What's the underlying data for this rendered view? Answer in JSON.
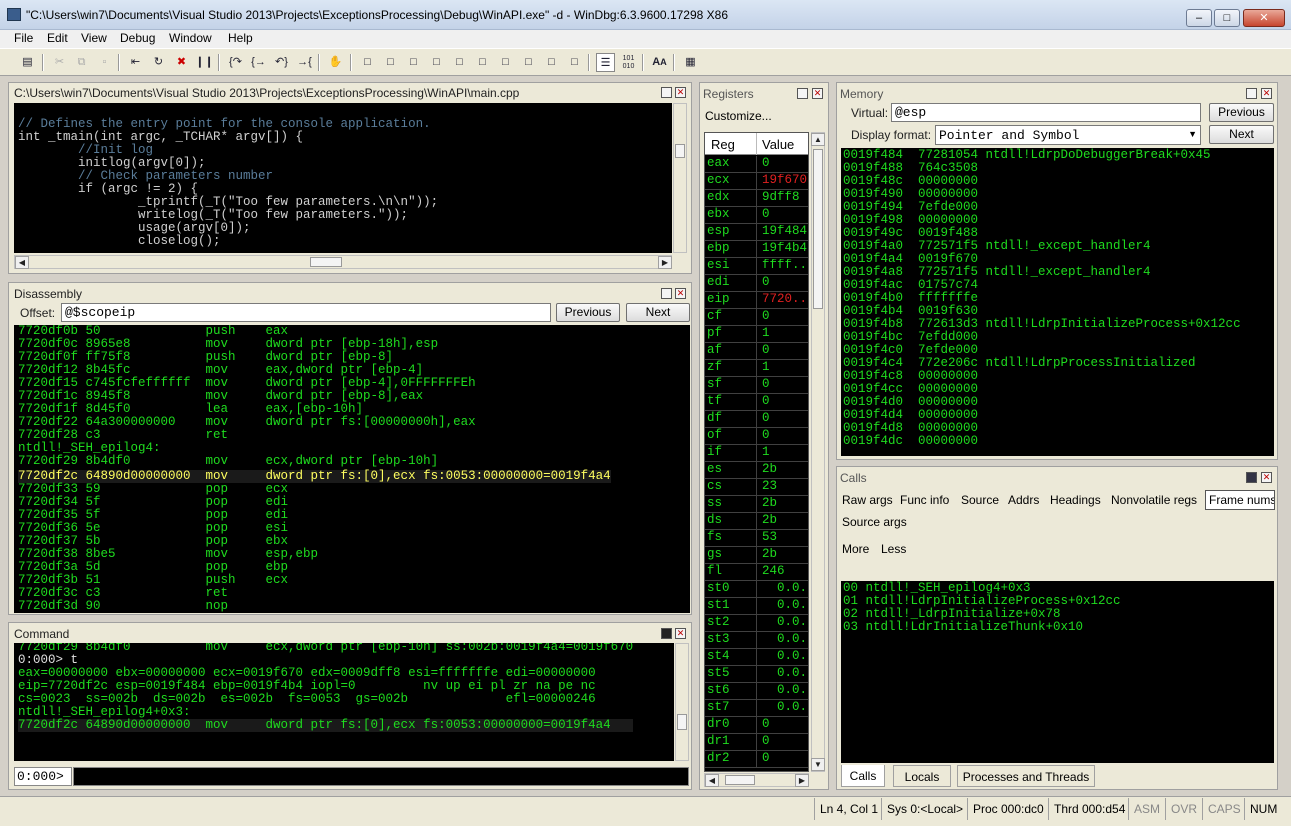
{
  "window": {
    "title": "\"C:\\Users\\win7\\Documents\\Visual Studio 2013\\Projects\\ExceptionsProcessing\\Debug\\WinAPI.exe\" -d - WinDbg:6.3.9600.17298 X86",
    "app_icon": "windbg-icon",
    "min_label": "–",
    "max_label": "□",
    "close_label": "✕"
  },
  "menu": [
    "File",
    "Edit",
    "View",
    "Debug",
    "Window",
    "Help"
  ],
  "source": {
    "title": "C:\\Users\\win7\\Documents\\Visual Studio 2013\\Projects\\ExceptionsProcessing\\WinAPI\\main.cpp",
    "lines": [
      {
        "t": "// Defines the entry point for the console application.",
        "c": "#5a7d9a"
      },
      {
        "t": "int _tmain(int argc, _TCHAR* argv[]) {",
        "c": "#d0d0d0"
      },
      {
        "t": "        //Init log",
        "c": "#5a7d9a"
      },
      {
        "t": "        initlog(argv[0]);",
        "c": "#d0d0d0"
      },
      {
        "t": "",
        "c": "#d0d0d0"
      },
      {
        "t": "        // Check parameters number",
        "c": "#5a7d9a"
      },
      {
        "t": "        if (argc != 2) {",
        "c": "#d0d0d0"
      },
      {
        "t": "                _tprintf(_T(\"Too few parameters.\\n\\n\"));",
        "c": "#d0d0d0"
      },
      {
        "t": "                writelog(_T(\"Too few parameters.\"));",
        "c": "#d0d0d0"
      },
      {
        "t": "                usage(argv[0]);",
        "c": "#d0d0d0"
      },
      {
        "t": "                closelog();",
        "c": "#d0d0d0"
      }
    ]
  },
  "disassembly": {
    "title": "Disassembly",
    "offset_label": "Offset:",
    "offset_value": "@$scopeip",
    "previous": "Previous",
    "next": "Next",
    "lines": [
      {
        "t": "7720df0b 50              push    eax",
        "h": false
      },
      {
        "t": "7720df0c 8965e8          mov     dword ptr [ebp-18h],esp",
        "h": false
      },
      {
        "t": "7720df0f ff75f8          push    dword ptr [ebp-8]",
        "h": false
      },
      {
        "t": "7720df12 8b45fc          mov     eax,dword ptr [ebp-4]",
        "h": false
      },
      {
        "t": "7720df15 c745fcfeffffff  mov     dword ptr [ebp-4],0FFFFFFFEh",
        "h": false
      },
      {
        "t": "7720df1c 8945f8          mov     dword ptr [ebp-8],eax",
        "h": false
      },
      {
        "t": "7720df1f 8d45f0          lea     eax,[ebp-10h]",
        "h": false
      },
      {
        "t": "7720df22 64a300000000    mov     dword ptr fs:[00000000h],eax",
        "h": false
      },
      {
        "t": "7720df28 c3              ret",
        "h": false
      },
      {
        "t": "ntdll!_SEH_epilog4:",
        "h": false
      },
      {
        "t": "7720df29 8b4df0          mov     ecx,dword ptr [ebp-10h]",
        "h": false
      },
      {
        "t": "7720df2c 64890d00000000  mov     dword ptr fs:[0],ecx fs:0053:00000000=0019f4a4",
        "h": true
      },
      {
        "t": "7720df33 59              pop     ecx",
        "h": false
      },
      {
        "t": "7720df34 5f              pop     edi",
        "h": false
      },
      {
        "t": "7720df35 5f              pop     edi",
        "h": false
      },
      {
        "t": "7720df36 5e              pop     esi",
        "h": false
      },
      {
        "t": "7720df37 5b              pop     ebx",
        "h": false
      },
      {
        "t": "7720df38 8be5            mov     esp,ebp",
        "h": false
      },
      {
        "t": "7720df3a 5d              pop     ebp",
        "h": false
      },
      {
        "t": "7720df3b 51              push    ecx",
        "h": false
      },
      {
        "t": "7720df3c c3              ret",
        "h": false
      },
      {
        "t": "7720df3d 90              nop",
        "h": false
      }
    ]
  },
  "command": {
    "title": "Command",
    "prompt": "0:000>",
    "lines": [
      "7720df29 8b4df0          mov     ecx,dword ptr [ebp-10h] ss:002b:0019f4a4=0019f670",
      "0:000> t",
      "eax=00000000 ebx=00000000 ecx=0019f670 edx=0009dff8 esi=fffffffe edi=00000000",
      "eip=7720df2c esp=0019f484 ebp=0019f4b4 iopl=0         nv up ei pl zr na pe nc",
      "cs=0023  ss=002b  ds=002b  es=002b  fs=0053  gs=002b             efl=00000246",
      "ntdll!_SEH_epilog4+0x3:",
      "7720df2c 64890d00000000  mov     dword ptr fs:[0],ecx fs:0053:00000000=0019f4a4"
    ]
  },
  "registers": {
    "title": "Registers",
    "customize": "Customize...",
    "col_reg": "Reg",
    "col_value": "Value",
    "rows": [
      {
        "n": "eax",
        "v": "0",
        "r": false
      },
      {
        "n": "ecx",
        "v": "19f670",
        "r": true
      },
      {
        "n": "edx",
        "v": "9dff8",
        "r": false
      },
      {
        "n": "ebx",
        "v": "0",
        "r": false
      },
      {
        "n": "esp",
        "v": "19f484",
        "r": false
      },
      {
        "n": "ebp",
        "v": "19f4b4",
        "r": false
      },
      {
        "n": "esi",
        "v": "ffff...",
        "r": false
      },
      {
        "n": "edi",
        "v": "0",
        "r": false
      },
      {
        "n": "eip",
        "v": "7720...",
        "r": true
      },
      {
        "n": "cf",
        "v": "0",
        "r": false
      },
      {
        "n": "pf",
        "v": "1",
        "r": false
      },
      {
        "n": "af",
        "v": "0",
        "r": false
      },
      {
        "n": "zf",
        "v": "1",
        "r": false
      },
      {
        "n": "sf",
        "v": "0",
        "r": false
      },
      {
        "n": "tf",
        "v": "0",
        "r": false
      },
      {
        "n": "df",
        "v": "0",
        "r": false
      },
      {
        "n": "of",
        "v": "0",
        "r": false
      },
      {
        "n": "if",
        "v": "1",
        "r": false
      },
      {
        "n": "es",
        "v": "2b",
        "r": false
      },
      {
        "n": "cs",
        "v": "23",
        "r": false
      },
      {
        "n": "ss",
        "v": "2b",
        "r": false
      },
      {
        "n": "ds",
        "v": "2b",
        "r": false
      },
      {
        "n": "fs",
        "v": "53",
        "r": false
      },
      {
        "n": "gs",
        "v": "2b",
        "r": false
      },
      {
        "n": "fl",
        "v": "246",
        "r": false
      },
      {
        "n": "st0",
        "v": "  0.0...",
        "r": false
      },
      {
        "n": "st1",
        "v": "  0.0...",
        "r": false
      },
      {
        "n": "st2",
        "v": "  0.0...",
        "r": false
      },
      {
        "n": "st3",
        "v": "  0.0...",
        "r": false
      },
      {
        "n": "st4",
        "v": "  0.0...",
        "r": false
      },
      {
        "n": "st5",
        "v": "  0.0...",
        "r": false
      },
      {
        "n": "st6",
        "v": "  0.0...",
        "r": false
      },
      {
        "n": "st7",
        "v": "  0.0...",
        "r": false
      },
      {
        "n": "dr0",
        "v": "0",
        "r": false
      },
      {
        "n": "dr1",
        "v": "0",
        "r": false
      },
      {
        "n": "dr2",
        "v": "0",
        "r": false
      }
    ]
  },
  "memory": {
    "title": "Memory",
    "virtual_label": "Virtual:",
    "virtual_value": "@esp",
    "format_label": "Display format:",
    "format_value": "Pointer and Symbol",
    "previous": "Previous",
    "next": "Next",
    "lines": [
      "0019f484  77281054 ntdll!LdrpDoDebuggerBreak+0x45",
      "0019f488  764c3508",
      "0019f48c  00000000",
      "0019f490  00000000",
      "0019f494  7efde000",
      "0019f498  00000000",
      "0019f49c  0019f488",
      "0019f4a0  772571f5 ntdll!_except_handler4",
      "0019f4a4  0019f670",
      "0019f4a8  772571f5 ntdll!_except_handler4",
      "0019f4ac  01757c74",
      "0019f4b0  fffffffe",
      "0019f4b4  0019f630",
      "0019f4b8  772613d3 ntdll!LdrpInitializeProcess+0x12cc",
      "0019f4bc  7efdd000",
      "0019f4c0  7efde000",
      "0019f4c4  772e206c ntdll!LdrpProcessInitialized",
      "0019f4c8  00000000",
      "0019f4cc  00000000",
      "0019f4d0  00000000",
      "0019f4d4  00000000",
      "0019f4d8  00000000",
      "0019f4dc  00000000"
    ]
  },
  "calls": {
    "title": "Calls",
    "options": [
      "Raw args",
      "Func info",
      "Source",
      "Addrs",
      "Headings",
      "Nonvolatile regs",
      "Frame nums"
    ],
    "source_args": "Source args",
    "more": "More",
    "less": "Less",
    "frames": [
      "00 ntdll!_SEH_epilog4+0x3",
      "01 ntdll!LdrpInitializeProcess+0x12cc",
      "02 ntdll!_LdrpInitialize+0x78",
      "03 ntdll!LdrInitializeThunk+0x10"
    ],
    "tabs": [
      "Calls",
      "Locals",
      "Processes and Threads"
    ]
  },
  "status": {
    "position": "Ln 4, Col 1",
    "sys": "Sys 0:<Local>",
    "proc": "Proc 000:dc0",
    "thrd": "Thrd 000:d54",
    "asm": "ASM",
    "ovr": "OVR",
    "caps": "CAPS",
    "num": "NUM"
  },
  "colors": {
    "text_green": "#1fdc1f",
    "changed_red": "#e02020",
    "highlight_yellow": "#ffff60"
  }
}
